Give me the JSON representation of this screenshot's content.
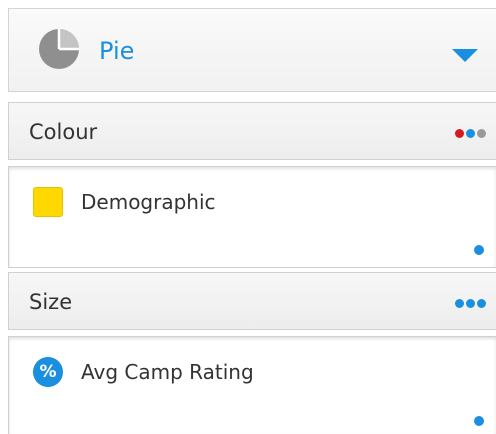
{
  "chart_type": {
    "label": "Pie",
    "icon": "pie-chart-icon",
    "accent_color": "#1a8fe0"
  },
  "colour_section": {
    "title": "Colour",
    "menu_icon": "more-dots-icon",
    "menu_dot_colors": [
      "#d71920",
      "#1a8fe0",
      "#9a9a9a"
    ],
    "field": {
      "label": "Demographic",
      "icon": "yellow-swatch-icon",
      "swatch_color": "#ffd800"
    }
  },
  "size_section": {
    "title": "Size",
    "menu_icon": "more-dots-icon",
    "menu_dot_colors": [
      "#1a8fe0",
      "#1a8fe0",
      "#1a8fe0"
    ],
    "field": {
      "label": "Avg Camp Rating",
      "icon": "percent-icon",
      "icon_glyph": "%"
    }
  }
}
